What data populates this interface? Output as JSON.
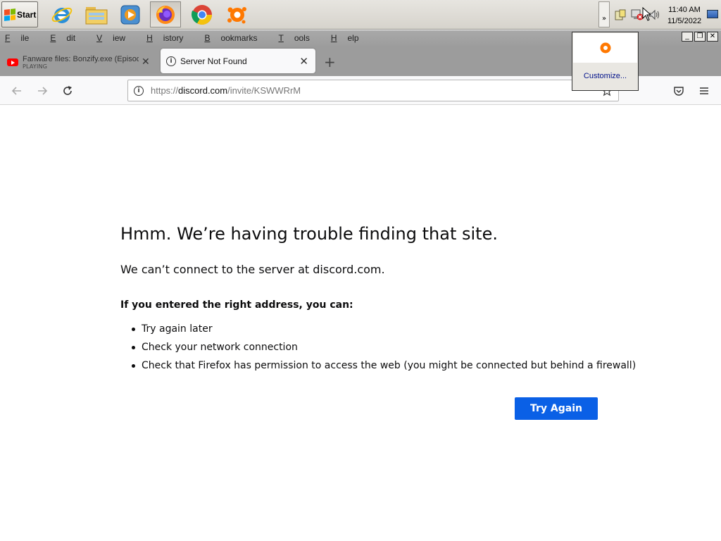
{
  "taskbar": {
    "start_label": "Start",
    "pinned": [
      {
        "name": "internet-explorer-icon"
      },
      {
        "name": "file-explorer-icon"
      },
      {
        "name": "media-player-icon"
      },
      {
        "name": "firefox-icon"
      },
      {
        "name": "chrome-icon"
      },
      {
        "name": "avast-icon"
      }
    ],
    "tray": {
      "time": "11:40 AM",
      "date": "11/5/2022",
      "chevron": "»"
    }
  },
  "tray_popup": {
    "customize_label": "Customize..."
  },
  "menubar": {
    "items": [
      {
        "label": "File",
        "u": "F",
        "rest": "ile"
      },
      {
        "label": "Edit",
        "u": "E",
        "rest": "dit"
      },
      {
        "label": "View",
        "u": "V",
        "rest": "iew"
      },
      {
        "label": "History",
        "u": "H",
        "rest": "istory"
      },
      {
        "label": "Bookmarks",
        "u": "B",
        "rest": "ookmarks"
      },
      {
        "label": "Tools",
        "u": "T",
        "rest": "ools"
      },
      {
        "label": "Help",
        "u": "H",
        "rest": "elp"
      }
    ]
  },
  "tabs": {
    "background_tab": {
      "title": "Fanware files: Bonzify.exe (Episod",
      "status": "PLAYING"
    },
    "active_tab": {
      "title": "Server Not Found"
    }
  },
  "urlbar": {
    "scheme": "https://",
    "host": "discord.com",
    "path": "/invite/KSWWRrM"
  },
  "error_page": {
    "title": "Hmm. We’re having trouble finding that site.",
    "subtitle": "We can’t connect to the server at discord.com.",
    "hint": "If you entered the right address, you can:",
    "suggestions": [
      "Try again later",
      "Check your network connection",
      "Check that Firefox has permission to access the web (you might be connected but behind a firewall)"
    ],
    "button_label": "Try Again"
  },
  "colors": {
    "primary_button": "#0a60e6",
    "chrome_gray": "#9c9c9c"
  }
}
